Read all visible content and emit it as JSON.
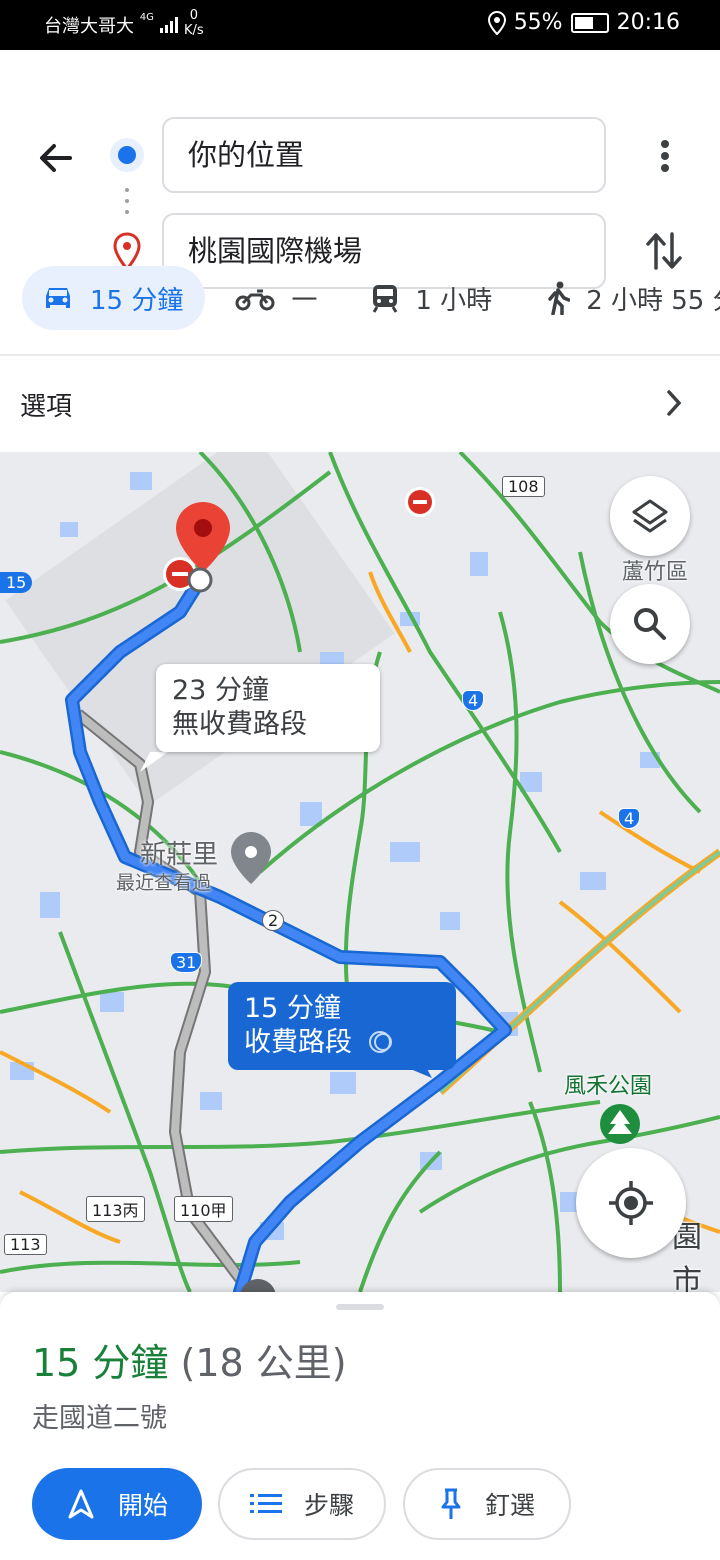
{
  "status_bar": {
    "carrier": "台灣大哥大",
    "network": "4G",
    "speed_value": "0",
    "speed_unit": "K/s",
    "battery": "55%",
    "time": "20:16"
  },
  "directions": {
    "origin": "你的位置",
    "destination": "桃園國際機場"
  },
  "travel_modes": [
    {
      "mode": "car-icon",
      "label": "15 分鐘",
      "selected": true
    },
    {
      "mode": "motorcycle-icon",
      "label": "一",
      "selected": false
    },
    {
      "mode": "transit-icon",
      "label": "1 小時",
      "selected": false
    },
    {
      "mode": "walk-icon",
      "label": "2 小時 55 分",
      "selected": false
    }
  ],
  "options": {
    "label": "選項"
  },
  "map": {
    "alt_route": {
      "time": "23 分鐘",
      "note": "無收費路段"
    },
    "main_route": {
      "time": "15 分鐘",
      "note": "收費路段"
    },
    "places": {
      "district": "蘆竹區",
      "recent_place": "新莊里",
      "recent_note": "最近查看過",
      "park": "風禾公園",
      "city_fragment": "園市"
    },
    "road_badges": [
      "108",
      "113丙",
      "110甲",
      "113",
      "15",
      "4",
      "4",
      "31",
      "2"
    ],
    "colors": {
      "route_main": "#4285f4",
      "route_alt": "#9e9e9e",
      "traffic_green": "#4caf50",
      "traffic_orange": "#f9a825",
      "destination_pin": "#ea4335"
    }
  },
  "summary": {
    "duration": "15 分鐘",
    "distance": "(18 公里)",
    "via": "走國道二號"
  },
  "actions": {
    "start": "開始",
    "steps": "步驟",
    "pin": "釘選"
  }
}
